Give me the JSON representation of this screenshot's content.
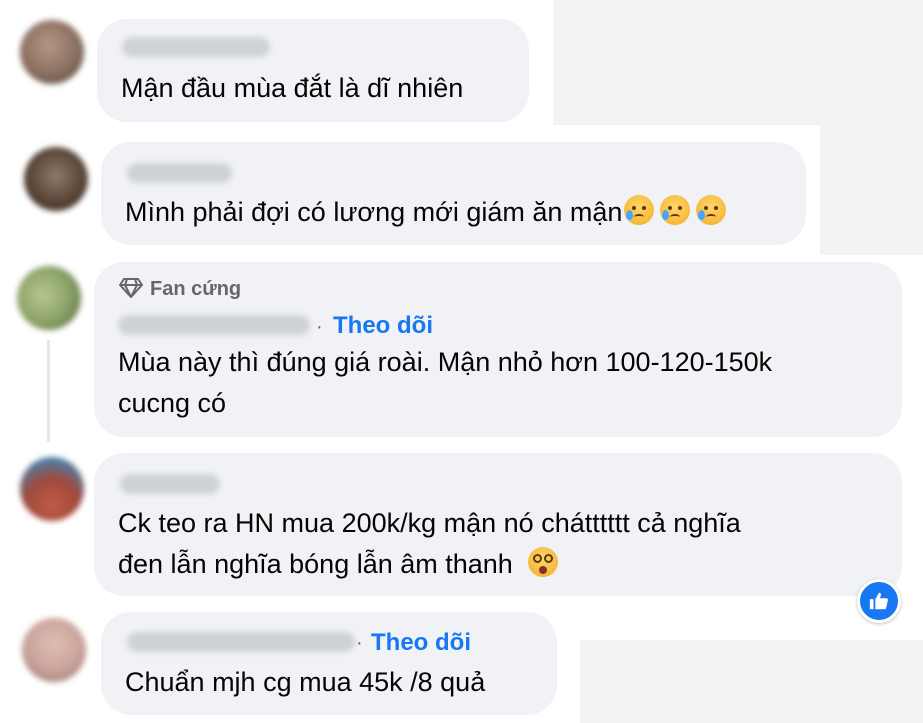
{
  "comments": [
    {
      "text": "Mận đầu mùa đắt là dĩ nhiên",
      "avatar_color": "#8a6f60"
    },
    {
      "text": "Mình phải đợi có lương mới giám ăn mận",
      "emojis": [
        "sad-tear-emoji",
        "sad-tear-emoji",
        "sad-tear-emoji"
      ],
      "avatar_color": "#5a4638"
    },
    {
      "badge": "Fan cứng",
      "follow": "Theo dõi",
      "lines": [
        "Mùa này thì đúng giá roài. Mận nhỏ hơn 100-120-150k",
        "cucng có"
      ],
      "avatar_color": "#8ea46a"
    },
    {
      "lines": [
        "Ck teo ra HN mua 200k/kg mận nó chátttttt cả nghĩa",
        "đen lẫn nghĩa bóng lẫn âm thanh"
      ],
      "emojis": [
        "dizzy-face-emoji"
      ],
      "avatar_color": "#a04a3c"
    },
    {
      "follow": "Theo dõi",
      "text": "Chuẩn mjh cg mua 45k /8 quả",
      "avatar_color": "#c9a39b"
    }
  ],
  "reaction": {
    "type": "like",
    "icon": "thumbs-up-icon",
    "color": "#1877f2"
  }
}
